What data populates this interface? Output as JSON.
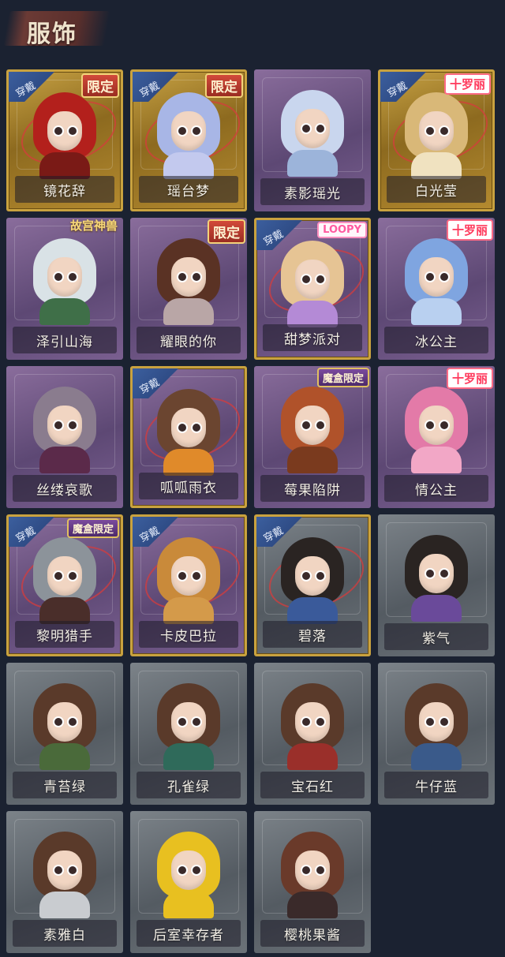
{
  "header": {
    "title": "服饰"
  },
  "labels": {
    "wear": "穿戴"
  },
  "colors": {
    "gold": "#c9a23f",
    "purple": "#5d4874",
    "gray": "#545b62"
  },
  "costumes": [
    {
      "name": "镜花辞",
      "tier": "gold",
      "equipped": true,
      "tag": "限定",
      "tag_type": "limited",
      "hair": "#b3201c",
      "body": "#7a1a16"
    },
    {
      "name": "瑶台梦",
      "tier": "gold",
      "equipped": true,
      "tag": "限定",
      "tag_type": "limited",
      "hair": "#a8b6e6",
      "body": "#c3c9ee"
    },
    {
      "name": "素影瑶光",
      "tier": "purple",
      "equipped": false,
      "tag": "",
      "tag_type": "",
      "hair": "#c9d6ee",
      "body": "#9cb4da"
    },
    {
      "name": "白光莹",
      "tier": "gold",
      "equipped": true,
      "tag": "十罗丽",
      "tag_type": "valentine",
      "hair": "#d9b878",
      "body": "#f0e2c0"
    },
    {
      "name": "泽引山海",
      "tier": "purple",
      "equipped": false,
      "tag": "故宫神兽",
      "tag_type": "ancient",
      "hair": "#d9e2e6",
      "body": "#3f6f48"
    },
    {
      "name": "耀眼的你",
      "tier": "purple",
      "equipped": false,
      "tag": "限定",
      "tag_type": "limited",
      "hair": "#5a3224",
      "body": "#b9a6a6"
    },
    {
      "name": "甜梦派对",
      "tier": "purple",
      "equipped": true,
      "tag": "LOOPY",
      "tag_type": "loopy",
      "hair": "#e6c494",
      "body": "#b48ad6"
    },
    {
      "name": "冰公主",
      "tier": "purple",
      "equipped": false,
      "tag": "十罗丽",
      "tag_type": "valentine",
      "hair": "#7fa5e0",
      "body": "#b9d0f0"
    },
    {
      "name": "丝缕哀歌",
      "tier": "purple",
      "equipped": false,
      "tag": "",
      "tag_type": "",
      "hair": "#8a7c8e",
      "body": "#5b2a4a"
    },
    {
      "name": "呱呱雨衣",
      "tier": "purple",
      "equipped": true,
      "tag": "",
      "tag_type": "",
      "hair": "#6b4530",
      "body": "#e08a2a"
    },
    {
      "name": "莓果陷阱",
      "tier": "purple",
      "equipped": false,
      "tag": "魔盒限定",
      "tag_type": "box",
      "hair": "#b0522a",
      "body": "#7a3a1e"
    },
    {
      "name": "情公主",
      "tier": "purple",
      "equipped": false,
      "tag": "十罗丽",
      "tag_type": "valentine",
      "hair": "#e37aa8",
      "body": "#f2a7c6"
    },
    {
      "name": "黎明猎手",
      "tier": "purple",
      "equipped": true,
      "tag": "魔盒限定",
      "tag_type": "box",
      "hair": "#8c939a",
      "body": "#4a2e2a"
    },
    {
      "name": "卡皮巴拉",
      "tier": "purple",
      "equipped": true,
      "tag": "",
      "tag_type": "",
      "hair": "#c98a3a",
      "body": "#d49a4a"
    },
    {
      "name": "碧落",
      "tier": "gray",
      "equipped": true,
      "tag": "",
      "tag_type": "",
      "hair": "#2a2422",
      "body": "#3a5a9a"
    },
    {
      "name": "紫气",
      "tier": "gray",
      "equipped": false,
      "tag": "",
      "tag_type": "",
      "hair": "#2a2422",
      "body": "#6a4a9a"
    },
    {
      "name": "青苔绿",
      "tier": "gray",
      "equipped": false,
      "tag": "",
      "tag_type": "",
      "hair": "#5a3a2a",
      "body": "#4a6a3a"
    },
    {
      "name": "孔雀绿",
      "tier": "gray",
      "equipped": false,
      "tag": "",
      "tag_type": "",
      "hair": "#5a3a2a",
      "body": "#2f6a5a"
    },
    {
      "name": "宝石红",
      "tier": "gray",
      "equipped": false,
      "tag": "",
      "tag_type": "",
      "hair": "#5a3a2a",
      "body": "#9a2f2a"
    },
    {
      "name": "牛仔蓝",
      "tier": "gray",
      "equipped": false,
      "tag": "",
      "tag_type": "",
      "hair": "#5a3a2a",
      "body": "#3a5a8a"
    },
    {
      "name": "素雅白",
      "tier": "gray",
      "equipped": false,
      "tag": "",
      "tag_type": "",
      "hair": "#5a3a2a",
      "body": "#c9ccd0"
    },
    {
      "name": "后室幸存者",
      "tier": "gray",
      "equipped": false,
      "tag": "",
      "tag_type": "",
      "hair": "#e8c020",
      "body": "#e8c020"
    },
    {
      "name": "樱桃果酱",
      "tier": "gray",
      "equipped": false,
      "tag": "",
      "tag_type": "",
      "hair": "#6a3a2a",
      "body": "#3a2a2a"
    }
  ]
}
